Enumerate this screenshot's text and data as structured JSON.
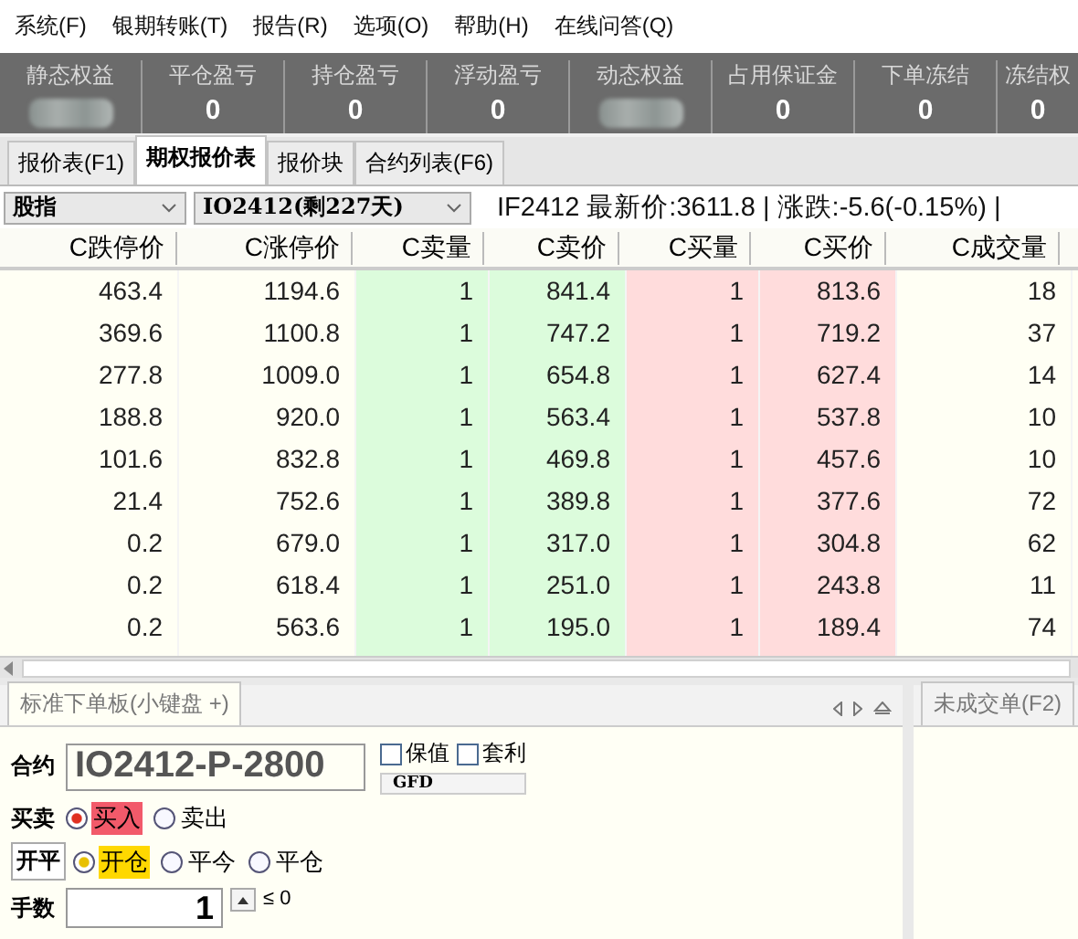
{
  "menu": [
    "系统(F)",
    "银期转账(T)",
    "报告(R)",
    "选项(O)",
    "帮助(H)",
    "在线问答(Q)"
  ],
  "account": [
    {
      "label": "静态权益",
      "redacted": true
    },
    {
      "label": "平仓盈亏",
      "value": "0",
      "redacted": false
    },
    {
      "label": "持仓盈亏",
      "value": "0",
      "redacted": false
    },
    {
      "label": "浮动盈亏",
      "value": "0",
      "redacted": false
    },
    {
      "label": "动态权益",
      "redacted": true
    },
    {
      "label": "占用保证金",
      "value": "0",
      "redacted": false
    },
    {
      "label": "下单冻结",
      "value": "0",
      "redacted": false
    },
    {
      "label": "冻结权",
      "value": "0",
      "redacted": false
    }
  ],
  "tabs": [
    {
      "label": "报价表(F1)",
      "selected": false
    },
    {
      "label": "期权报价表",
      "selected": true
    },
    {
      "label": "报价块",
      "selected": false
    },
    {
      "label": "合约列表(F6)",
      "selected": false
    }
  ],
  "selectors": [
    "股指",
    "IO2412(剩227天)"
  ],
  "quote": "IF2412 最新价:3611.8 | 涨跌:-5.6(-0.15%) |",
  "table": {
    "columns": [
      {
        "label": "C跌停价",
        "kind": "plain"
      },
      {
        "label": "C涨停价",
        "kind": "plain"
      },
      {
        "label": "C卖量",
        "kind": "ask"
      },
      {
        "label": "C卖价",
        "kind": "ask"
      },
      {
        "label": "C买量",
        "kind": "bid"
      },
      {
        "label": "C买价",
        "kind": "bid"
      },
      {
        "label": "C成交量",
        "kind": "plain"
      }
    ],
    "rows": [
      [
        "463.4",
        "1194.6",
        "1",
        "841.4",
        "1",
        "813.6",
        "18"
      ],
      [
        "369.6",
        "1100.8",
        "1",
        "747.2",
        "1",
        "719.2",
        "37"
      ],
      [
        "277.8",
        "1009.0",
        "1",
        "654.8",
        "1",
        "627.4",
        "14"
      ],
      [
        "188.8",
        "920.0",
        "1",
        "563.4",
        "1",
        "537.8",
        "10"
      ],
      [
        "101.6",
        "832.8",
        "1",
        "469.8",
        "1",
        "457.6",
        "10"
      ],
      [
        "21.4",
        "752.6",
        "1",
        "389.8",
        "1",
        "377.6",
        "72"
      ],
      [
        "0.2",
        "679.0",
        "1",
        "317.0",
        "1",
        "304.8",
        "62"
      ],
      [
        "0.2",
        "618.4",
        "1",
        "251.0",
        "1",
        "243.8",
        "11"
      ],
      [
        "0.2",
        "563.6",
        "1",
        "195.0",
        "1",
        "189.4",
        "74"
      ]
    ]
  },
  "order_panel": {
    "tab": "标准下单板(小键盘 +)",
    "contract_label": "合约",
    "contract": "IO2412-P-2800",
    "checkboxes": [
      {
        "label": "保值",
        "checked": false
      },
      {
        "label": "套利",
        "checked": false
      }
    ],
    "tif": "GFD",
    "groups": [
      {
        "label": "买卖",
        "kind": "direction",
        "options": [
          {
            "label": "买入",
            "selected": true
          },
          {
            "label": "卖出",
            "selected": false
          }
        ]
      },
      {
        "label": "开平",
        "kind": "offset",
        "options": [
          {
            "label": "开仓",
            "selected": true
          },
          {
            "label": "平今",
            "selected": false
          },
          {
            "label": "平仓",
            "selected": false
          }
        ]
      }
    ],
    "qty_label": "手数",
    "qty": "1",
    "limit": "≤ 0"
  },
  "side_panel": {
    "tab": "未成交单(F2)"
  }
}
